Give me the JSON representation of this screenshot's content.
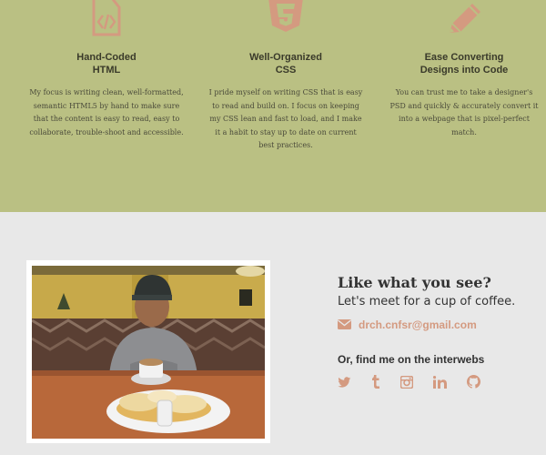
{
  "skills": [
    {
      "title": "Hand-Coded\nHTML",
      "text": "My focus is writing clean, well-formatted, semantic HTML5 by hand to make sure that the content is easy to read, easy to collaborate, trouble-shoot and accessible.",
      "icon": "code-file-icon"
    },
    {
      "title": "Well-Organized\nCSS",
      "text": "I pride myself on writing CSS that is easy to read and build on. I focus on keeping my CSS lean and fast to load, and I make it a habit to stay up to date on current best practices.",
      "icon": "css3-icon"
    },
    {
      "title": "Ease Converting\nDesigns into Code",
      "text": "You can trust me to take a designer's PSD and quickly & accurately convert it into a webpage that is pixel-perfect match.",
      "icon": "pencil-icon"
    }
  ],
  "contact": {
    "heading": "Like what you see?",
    "subheading": "Let's meet for a cup of coffee.",
    "email": "drch.cnfsr@gmail.com",
    "social_heading": "Or, find me on the interwebs"
  },
  "socials": [
    "twitter-icon",
    "tumblr-icon",
    "instagram-icon",
    "linkedin-icon",
    "github-icon"
  ],
  "colors": {
    "skills_bg": "#bac083",
    "accent": "#d49a80",
    "page_bg": "#e8e8e8"
  }
}
